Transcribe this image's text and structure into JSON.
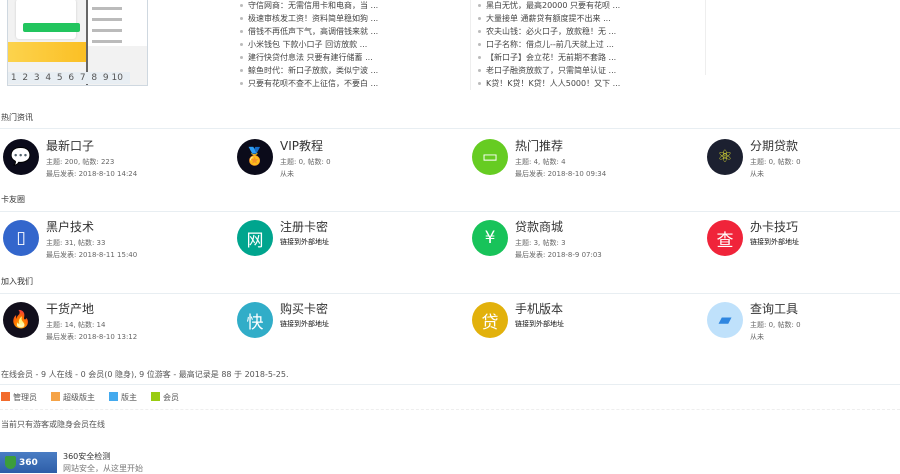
{
  "thumbnail": {
    "pager": [
      "1",
      "2",
      "3",
      "4",
      "5",
      "6",
      "7",
      "8",
      "9",
      "10"
    ]
  },
  "news_left": [
    "守信网商：无需信用卡和电商，当 ...",
    "极速审核发工资！资料简单稳如狗 ...",
    "借钱不再低声下气，高调借钱来就 ...",
    "小米钱包 下款小口子 回访放款 ...",
    "建行快贷付息法 只要有建行储蓄 ...",
    "鲸鱼时代：新口子放款，类似宁波 ...",
    "只要有花呗不查不上征信，不要白 ..."
  ],
  "news_right": [
    "黑白无忧，最高20000 只要有花呗 ...",
    "大量接单 通薪贷有额度提不出来 ...",
    "农夫山钱：必火口子，放款稳！无 ...",
    "口子名称：借点儿--前几天就上过 ...",
    "【新口子】会立花！无前期不套路 ...",
    "老口子融资放款了，只需简单认证 ...",
    "K贷！K贷！K贷！人人5000！又下 ..."
  ],
  "sections": [
    {
      "title": "热门资讯",
      "forums": [
        {
          "name": "最新口子",
          "icon": "chat-icon",
          "color": "#0b0b1a",
          "glyph": "💬",
          "stats": "主题: 200, 帖数: 223",
          "last": "最后发表: 2018-8-10 14:24"
        },
        {
          "name": "VIP教程",
          "icon": "medal-icon",
          "color": "#0b0b1a",
          "glyph": "🏅",
          "stats": "主题: 0, 帖数: 0",
          "last": "从未"
        },
        {
          "name": "热门推荐",
          "icon": "card-icon",
          "color": "#66cc22",
          "glyph": "▭",
          "stats": "主题: 4, 帖数: 4",
          "last": "最后发表: 2018-8-10 09:34"
        },
        {
          "name": "分期贷款",
          "icon": "atom-icon",
          "color": "#1c2030",
          "glyph": "⚛",
          "stats": "主题: 0, 帖数: 0",
          "last": "从未"
        }
      ]
    },
    {
      "title": "卡友圈",
      "forums": [
        {
          "name": "黑户技术",
          "icon": "building-icon",
          "color": "#3366cc",
          "glyph": "▯",
          "stats": "主题: 31, 帖数: 33",
          "last": "最后发表: 2018-8-11 15:40"
        },
        {
          "name": "注册卡密",
          "icon": "net-icon",
          "color": "#00a58e",
          "glyph": "网",
          "link": "链接到外部地址"
        },
        {
          "name": "贷款商城",
          "icon": "yen-icon",
          "color": "#18c35a",
          "glyph": "¥",
          "stats": "主题: 3, 帖数: 3",
          "last": "最后发表: 2018-8-9 07:03"
        },
        {
          "name": "办卡技巧",
          "icon": "search-icon",
          "color": "#f0243a",
          "glyph": "查",
          "link": "链接到外部地址"
        }
      ]
    },
    {
      "title": "加入我们",
      "forums": [
        {
          "name": "干货产地",
          "icon": "fire-icon",
          "color": "#120f1c",
          "glyph": "🔥",
          "stats": "主题: 14, 帖数: 14",
          "last": "最后发表: 2018-8-10 13:12"
        },
        {
          "name": "购买卡密",
          "icon": "fast-icon",
          "color": "#31adc8",
          "glyph": "快",
          "link": "链接到外部地址"
        },
        {
          "name": "手机版本",
          "icon": "loan-icon",
          "color": "#e2b10c",
          "glyph": "贷",
          "link": "链接到外部地址"
        },
        {
          "name": "查询工具",
          "icon": "tool-icon",
          "color": "#bfe1fb",
          "glyph": "▰",
          "stats": "主题: 0, 帖数: 0",
          "last": "从未"
        }
      ]
    }
  ],
  "online": "在线会员 - 9 人在线 - 0 会员(0 隐身), 9 位游客 - 最高记录是 88 于 2018-5-25.",
  "legend": [
    {
      "label": "管理员",
      "color": "#f26b2c"
    },
    {
      "label": "超级版主",
      "color": "#f5a347"
    },
    {
      "label": "版主",
      "color": "#44aaee"
    },
    {
      "label": "会员",
      "color": "#99cc11"
    }
  ],
  "guest_note": "当前只有游客或隐身会员在线",
  "security": {
    "logo": "360",
    "title": "360安全检测",
    "subtitle": "网站安全，从这里开始"
  }
}
